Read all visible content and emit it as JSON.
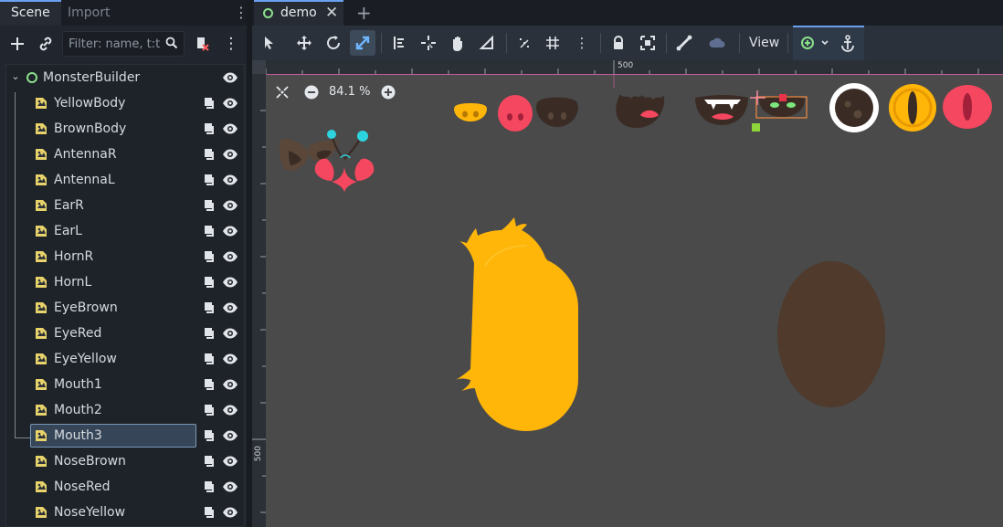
{
  "dock": {
    "tabs": {
      "scene": "Scene",
      "import": "Import"
    },
    "filter_placeholder": "Filter: name, t:t",
    "root": "MonsterBuilder",
    "nodes": [
      "YellowBody",
      "BrownBody",
      "AntennaR",
      "AntennaL",
      "EarR",
      "EarL",
      "HornR",
      "HornL",
      "EyeBrown",
      "EyeRed",
      "EyeYellow",
      "Mouth1",
      "Mouth2",
      "Mouth3",
      "NoseBrown",
      "NoseRed",
      "NoseYellow"
    ],
    "selected": "Mouth3"
  },
  "editor": {
    "tab_name": "demo",
    "view_menu": "View",
    "zoom": "84.1 %",
    "ruler_top_label": "500",
    "ruler_left_label": "500"
  },
  "colors": {
    "accent": "#6aa0f0",
    "yellow": "#ffb608",
    "pink": "#f5475f",
    "brown": "#4f3a2b",
    "dark_brown": "#3a2c25",
    "viewport_bg": "#4a4a4a"
  }
}
